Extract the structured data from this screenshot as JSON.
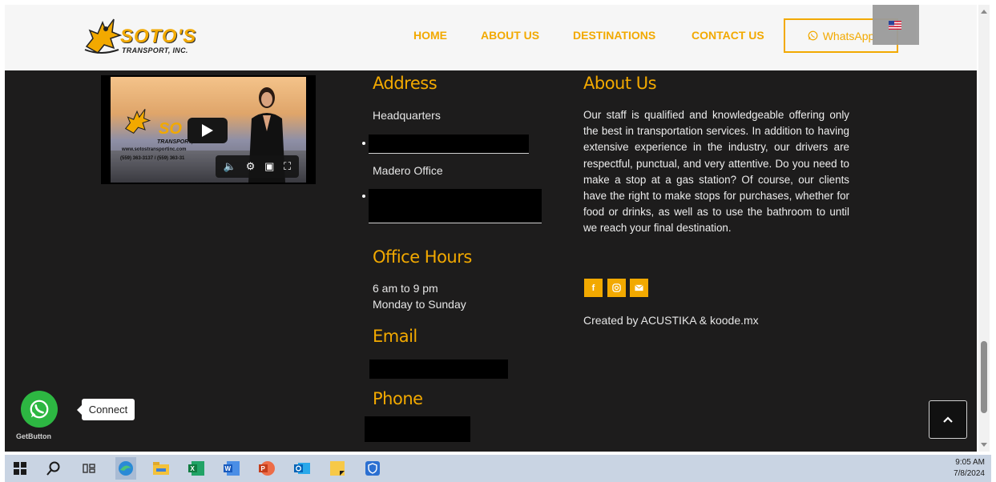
{
  "header": {
    "logo_text": "SOTO'S",
    "logo_sub": "TRANSPORT, INC.",
    "nav": [
      "HOME",
      "ABOUT US",
      "DESTINATIONS",
      "CONTACT US"
    ],
    "whatsapp_label": "WhatsApp"
  },
  "video": {
    "website": "www.sotostransportinc.com",
    "phones": "(559) 363-3137 / (559) 363-31",
    "brand_word": "SO",
    "brand_sub": "TRANSPORT, INC."
  },
  "address": {
    "title": "Address",
    "headquarters_label": "Headquarters",
    "madero_label": "Madero Office"
  },
  "office_hours": {
    "title": "Office Hours",
    "line1": "6 am to 9 pm",
    "line2": "Monday to Sunday"
  },
  "email": {
    "title": "Email"
  },
  "phone": {
    "title": "Phone"
  },
  "about": {
    "title": "About Us",
    "text": "Our staff is qualified and knowledgeable offering only the best in transportation services. In addition to having extensive experience in the industry, our drivers are respectful, punctual, and very attentive. Do you need to make a stop at a gas station? Of course, our clients have the right to make stops for purchases, whether for food or drinks, as well as to use the bathroom to until we reach your final destination.",
    "credits": "Created by ACUSTIKA & koode.mx",
    "social_icons": [
      "facebook-icon",
      "instagram-icon",
      "email-icon"
    ]
  },
  "floating": {
    "connect_label": "Connect",
    "getbutton_label": "GetButton"
  },
  "taskbar": {
    "time": "9:05 AM",
    "date": "7/8/2024",
    "apps": [
      "windows-start-icon",
      "search-icon",
      "task-view-icon",
      "edge-icon",
      "file-explorer-icon",
      "excel-icon",
      "word-icon",
      "powerpoint-icon",
      "outlook-icon",
      "sticky-notes-icon",
      "security-icon"
    ]
  },
  "colors": {
    "accent": "#f2a900",
    "background": "#1d1c1c",
    "whatsapp_green": "#2db742",
    "taskbar": "#c9d4e3"
  }
}
